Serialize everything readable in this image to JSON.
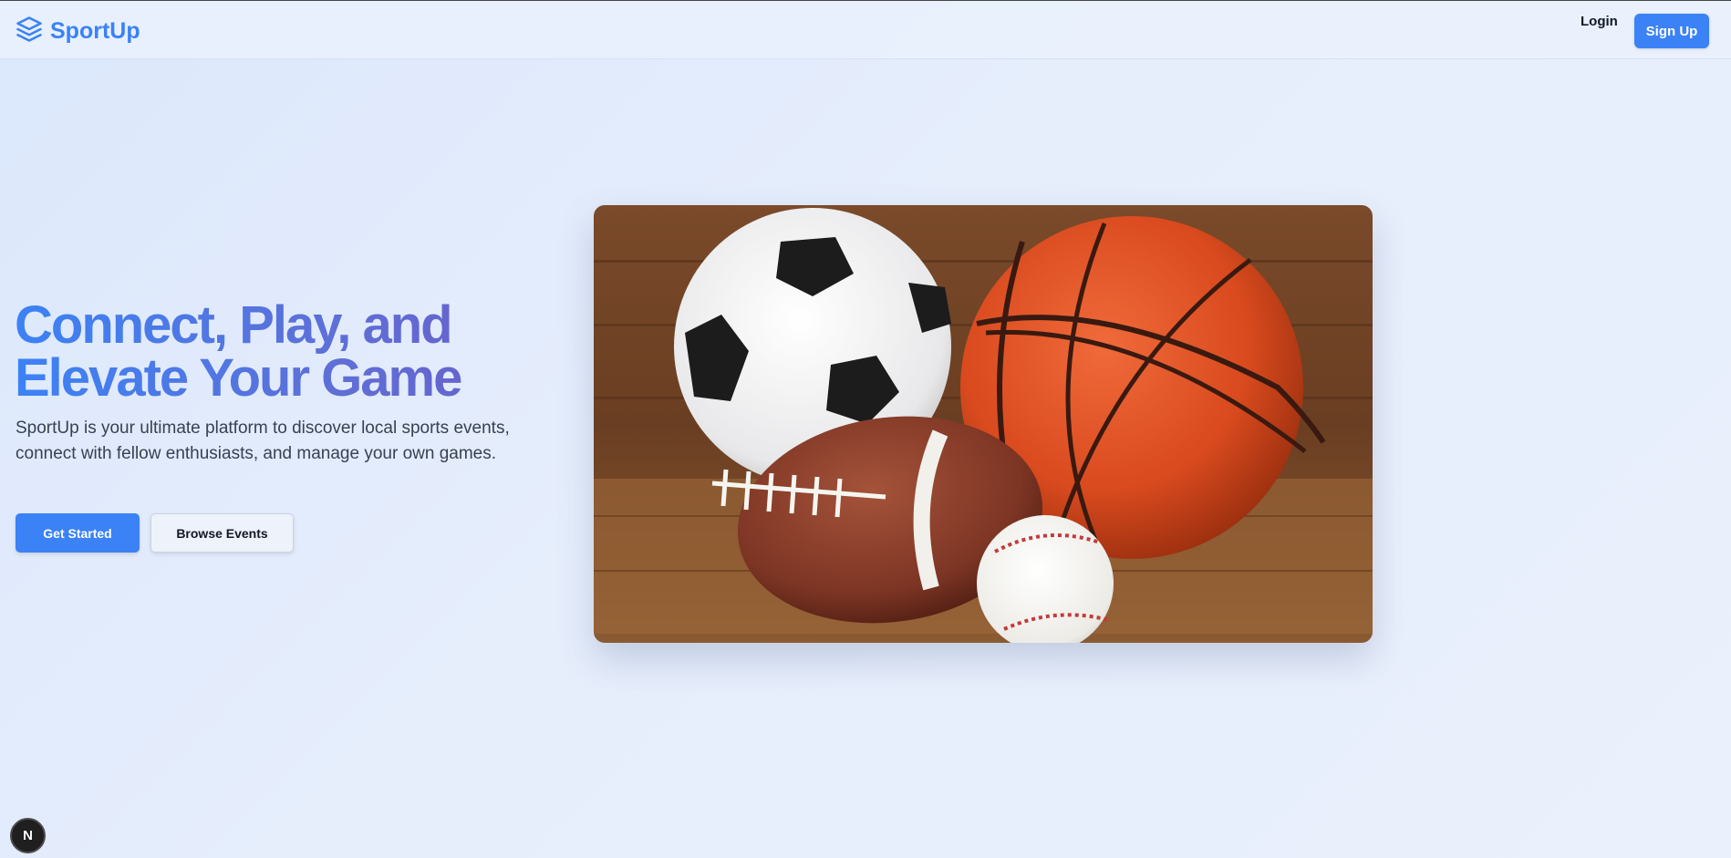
{
  "header": {
    "brand_name": "SportUp",
    "brand_icon": "layers-icon",
    "login_label": "Login",
    "signup_label": "Sign Up"
  },
  "hero": {
    "headline_line1": "Connect, Play, and",
    "headline_line2": "Elevate Your Game",
    "description": "SportUp is your ultimate platform to discover local sports events, connect with fellow enthusiasts, and manage your own games.",
    "primary_cta": "Get Started",
    "secondary_cta": "Browse Events",
    "image_alt": "sports balls"
  },
  "dev_badge": {
    "label": "N"
  },
  "colors": {
    "accent": "#3b82f6",
    "headline_gradient_start": "#3b82f6",
    "headline_gradient_end": "#6b5bc8",
    "background": "#e3ecfc"
  }
}
